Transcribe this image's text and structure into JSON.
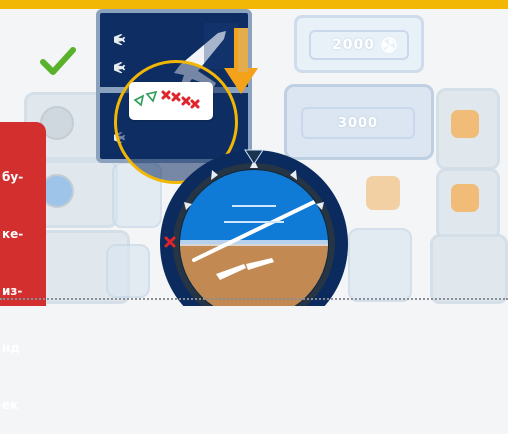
{
  "colors": {
    "accent": "#f2b705",
    "navy": "#0e2d63",
    "red": "#d32f2f",
    "check_green": "#5ab12b",
    "arrow_orange": "#f4a21a"
  },
  "icons": {
    "check": "check-icon",
    "plane": "airplane-icon",
    "down_arrow": "down-arrow-icon",
    "magnifier": "magnifier-circle",
    "marks": "hits-and-misses-icon"
  },
  "displays": {
    "upper_value": "2000",
    "lower_value": "3000"
  },
  "side_panel": {
    "lines": [
      "бу-",
      "ке-",
      "из-",
      "нд",
      "ек"
    ]
  }
}
